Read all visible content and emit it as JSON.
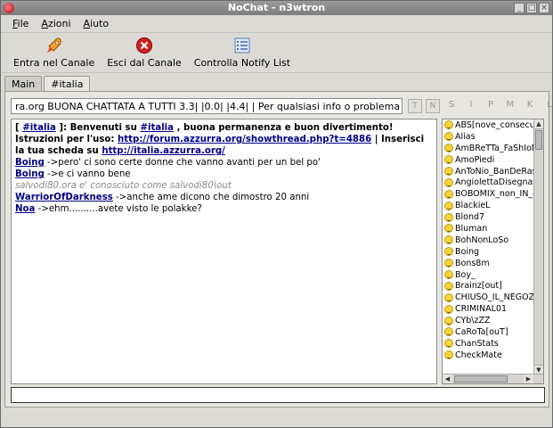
{
  "window": {
    "title": "NoChat - n3wtron",
    "buttons": [
      "_",
      "□",
      "×"
    ]
  },
  "menu": [
    {
      "first": "F",
      "rest": "ile"
    },
    {
      "first": "A",
      "rest": "zioni"
    },
    {
      "first": "A",
      "rest": "iuto"
    }
  ],
  "toolbar": {
    "join": "Entra nel Canale",
    "leave": "Esci dal Canale",
    "notify": "Controlla Notify List"
  },
  "tabs": {
    "main": "Main",
    "channel": "#italia"
  },
  "topic": "ra.org  BUONA CHATTATA A TUTTI 3.3| |0.0| |4.4| | Per qualsiasi info o problema #ItaliaHelp |",
  "modes": [
    "T",
    "N",
    "S",
    "I",
    "P",
    "M",
    "K",
    "L"
  ],
  "chat": {
    "welcome_open": "[ ",
    "welcome_chan": "#italia",
    "welcome_mid": " ]: Benvenuti su ",
    "welcome_chan2": "#italia",
    "welcome_rest": " , buona permanenza e buon divertimento! Istruzioni per l'uso: ",
    "welcome_link": "http://forum.azzurra.org/showthread.php?t=4886",
    "welcome_rest2": " | Inserisci la tua scheda su ",
    "welcome_link2": "http://italia.azzurra.org/",
    "messages": [
      {
        "nick": "Boing",
        "text": " ->pero' ci sono certe donne che vanno avanti per un bel po'"
      },
      {
        "nick": "Boing",
        "text": " ->e ci vanno bene"
      },
      {
        "system": "salvodi80.ora e' conosciuto come salvodi80\\out"
      },
      {
        "nick": "WarriorOfDarkness",
        "text": " ->anche ame dicono che dimostro 20 anni"
      },
      {
        "nick": "Noa",
        "text": " ->ehm..........avete visto le polakke?"
      }
    ]
  },
  "users": [
    "ABS[nove_consecu",
    "Alias",
    "AmBReTTa_FaShIoN",
    "AmoPiedi",
    "AnToNio_BanDeRas",
    "AngiolettaDisegnat",
    "BOBOMIX_non_IN_c",
    "BlackieL",
    "Blond7",
    "Bluman",
    "BohNonLoSo",
    "Boing",
    "Bons8m",
    "Boy_",
    "Brainz[out]",
    "CHIUSO_IL_NEGOZ",
    "CRIMINAL01",
    "CYb\\zZZ",
    "CaRoTa[ouT]",
    "ChanStats",
    "CheckMate"
  ],
  "colors": {
    "nick": "#000080",
    "link": "#00008b",
    "system": "#8a8a8a"
  }
}
